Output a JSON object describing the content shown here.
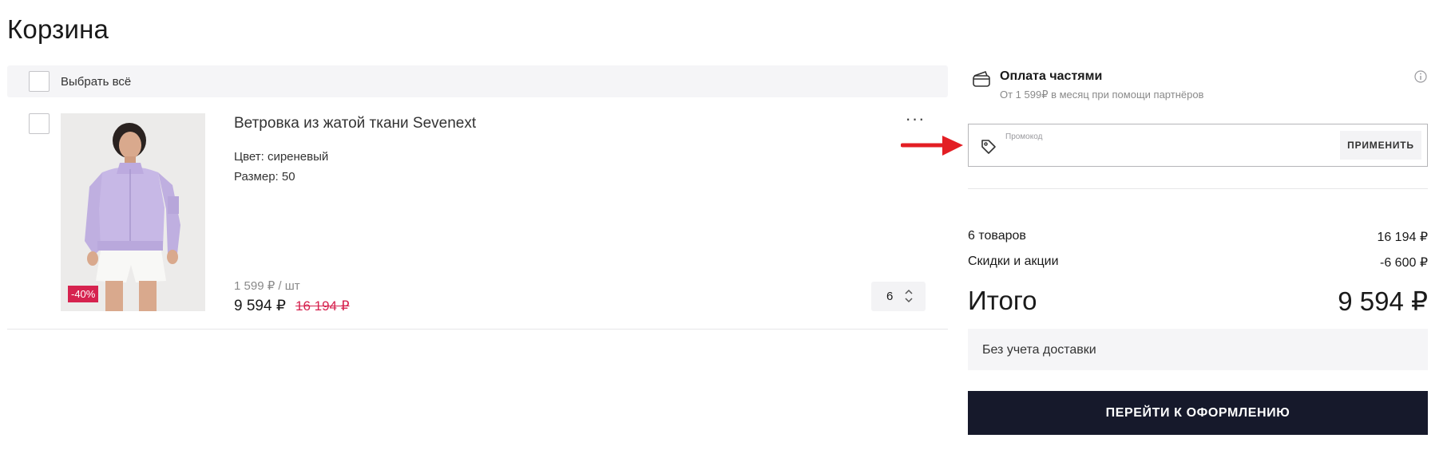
{
  "page": {
    "title": "Корзина"
  },
  "select_all": {
    "label": "Выбрать всё"
  },
  "item": {
    "name": "Ветровка из жатой ткани Sevenext",
    "color": "Цвет: сиреневый",
    "size": "Размер: 50",
    "discount_badge": "-40%",
    "unit_price": "1 599 ₽ / шт",
    "price_current": "9 594 ₽",
    "price_old": "16 194 ₽",
    "quantity": "6",
    "more_label": "···"
  },
  "installments": {
    "title": "Оплата частями",
    "subtitle": "От 1 599₽ в месяц при помощи партнёров"
  },
  "promo": {
    "label": "Промокод",
    "value": "",
    "apply_label": "ПРИМЕНИТЬ"
  },
  "summary": {
    "goods_label": "6 товаров",
    "goods_value": "16 194 ₽",
    "discounts_label": "Скидки и акции",
    "discounts_value": "-6 600 ₽",
    "total_label": "Итого",
    "total_value": "9 594 ₽",
    "delivery_note": "Без учета доставки",
    "checkout_label": "ПЕРЕЙТИ К ОФОРМЛЕНИЮ"
  },
  "colors": {
    "accent": "#d6234f",
    "checkout_bg": "#16192b",
    "arrow": "#e31e24",
    "product_color": "#c7b8e6"
  },
  "icons": {
    "installments": "wallet-icon",
    "info": "info-icon",
    "promo": "tag-icon",
    "quantity": "chevron-updown-icon",
    "arrow": "red-arrow-icon"
  }
}
